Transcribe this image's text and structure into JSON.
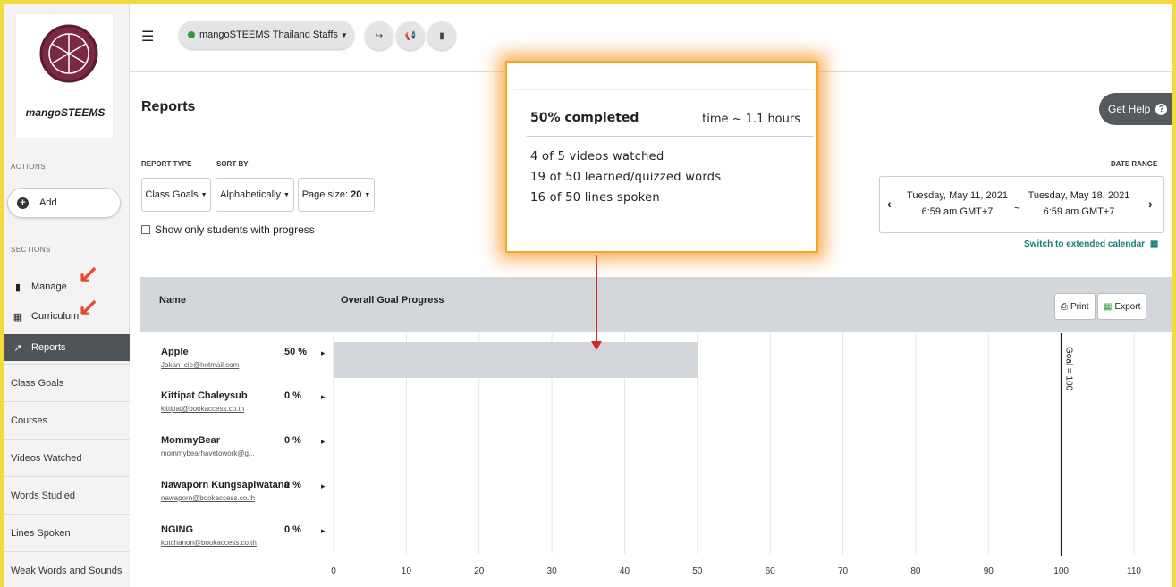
{
  "sidebar": {
    "logo_text": "mangoSTEEMS",
    "actions_label": "ACTIONS",
    "add_label": "Add",
    "sections_label": "SECTIONS",
    "nav": [
      {
        "label": "Manage",
        "icon": "clipboard-icon"
      },
      {
        "label": "Curriculum",
        "icon": "book-icon"
      },
      {
        "label": "Reports",
        "icon": "chart-icon"
      }
    ],
    "report_items": [
      "Class Goals",
      "Courses",
      "Videos Watched",
      "Words Studied",
      "Lines Spoken",
      "Weak Words and Sounds"
    ]
  },
  "topbar": {
    "org_name": "mangoSTEEMS Thailand Staffs",
    "org_status_color": "#2e9c3e"
  },
  "main": {
    "title": "Reports",
    "help_label": "Get Help",
    "report_type_label": "REPORT TYPE",
    "sort_by_label": "SORT BY",
    "report_type_value": "Class Goals",
    "sort_by_value": "Alphabetically",
    "page_size_label": "Page size:",
    "page_size_value": "20",
    "show_only_label": "Show only students with progress",
    "date_range_label": "DATE RANGE",
    "date_start_day": "Tuesday, May 11, 2021",
    "date_start_time": "6:59 am GMT+7",
    "date_sep": "~",
    "date_end_day": "Tuesday, May 18, 2021",
    "date_end_time": "6:59 am GMT+7",
    "switch_calendar": "Switch to extended calendar",
    "table": {
      "col_name": "Name",
      "col_progress": "Overall Goal Progress",
      "print_label": "Print",
      "export_label": "Export"
    },
    "students": [
      {
        "name": "Apple",
        "email": "Jakan_cie@hotmail.com",
        "pct": "50 %"
      },
      {
        "name": "Kittipat Chaleysub",
        "email": "kittipat@bookaccess.co.th",
        "pct": "0 %"
      },
      {
        "name": "MommyBear",
        "email": "mommybearhavetowork@g...",
        "pct": "0 %"
      },
      {
        "name": "Nawaporn Kungsapiwatana",
        "email": "nawaporn@bookaccess.co.th",
        "pct": "0 %"
      },
      {
        "name": "NGING",
        "email": "kotchanon@bookaccess.co.th",
        "pct": "0 %"
      }
    ]
  },
  "tooltip": {
    "title": "50% completed",
    "time": "time ~ 1.1 hours",
    "lines": [
      "4 of 5 videos watched",
      "19 of 50 learned/quizzed words",
      "16 of 50 lines spoken"
    ]
  },
  "chart_data": {
    "type": "bar",
    "orientation": "horizontal",
    "categories": [
      "Apple",
      "Kittipat Chaleysub",
      "MommyBear",
      "Nawaporn Kungsapiwatana",
      "NGING"
    ],
    "values": [
      50,
      0,
      0,
      0,
      0
    ],
    "xlim": [
      0,
      110
    ],
    "xticks": [
      0,
      10,
      20,
      30,
      40,
      50,
      60,
      70,
      80,
      90,
      100,
      110
    ],
    "goal_value": 100,
    "goal_label": "Goal = 100",
    "bar_color": "#d3d6da",
    "grid": true
  }
}
